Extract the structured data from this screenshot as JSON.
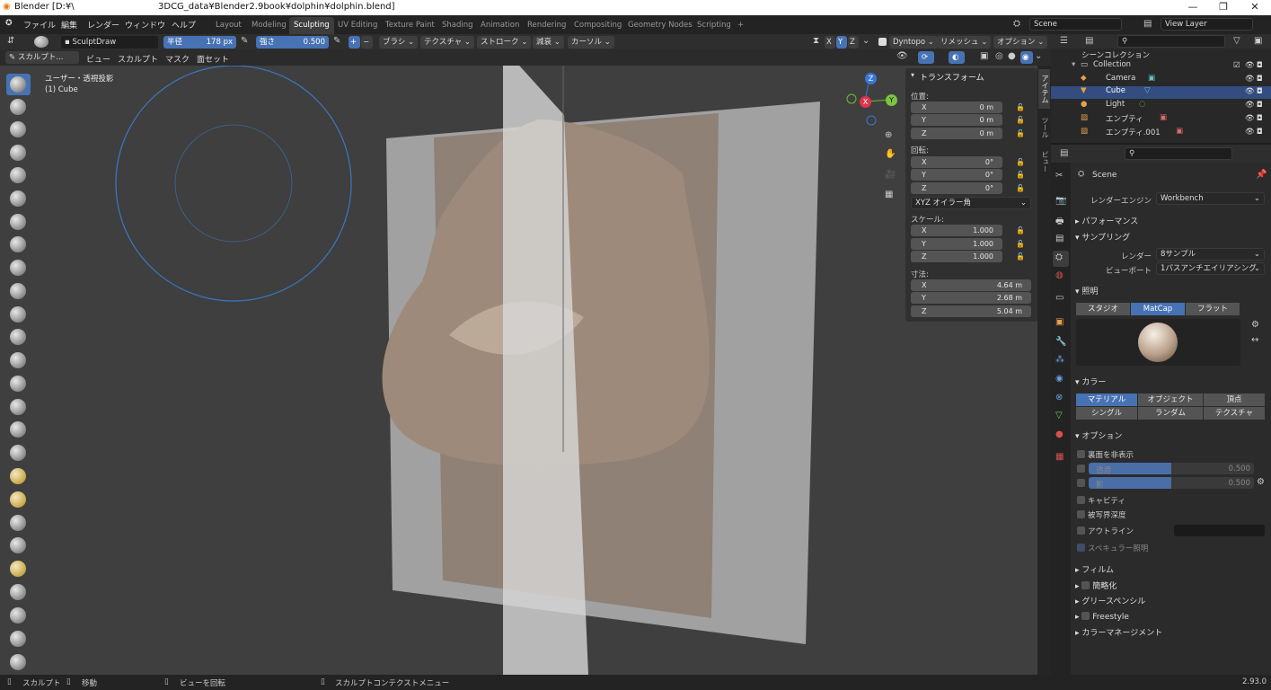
{
  "title": {
    "app": "Blender [D:¥\\",
    "path": "3DCG_data¥Blender2.9book¥dolphin¥dolphin.blend]"
  },
  "window_buttons": [
    "—",
    "❐",
    "✕"
  ],
  "menus": [
    "ファイル",
    "編集",
    "レンダー",
    "ウィンドウ",
    "ヘルプ"
  ],
  "workspaces": [
    "Layout",
    "Modeling",
    "Sculpting",
    "UV Editing",
    "Texture Paint",
    "Shading",
    "Animation",
    "Rendering",
    "Compositing",
    "Geometry Nodes",
    "Scripting"
  ],
  "active_workspace": "Sculpting",
  "add_tab": "+",
  "scene": "Scene",
  "view_layer": "View Layer",
  "tool_header": {
    "brush": "SculptDraw",
    "radius_label": "半径",
    "radius_value": "178 px",
    "strength_label": "強さ",
    "strength_value": "0.500",
    "plus": "+",
    "minus": "−",
    "menus": [
      "ブラシ",
      "テクスチャ",
      "ストローク",
      "減衰",
      "カーソル"
    ],
    "axes": [
      "X",
      "Y",
      "Z"
    ],
    "dyntopo": "Dyntopo",
    "remesh": "リメッシュ",
    "options": "オプション"
  },
  "mode_header": {
    "mode": "スカルプト...",
    "menus": [
      "ビュー",
      "スカルプト",
      "マスク",
      "面セット"
    ]
  },
  "viewport": {
    "view_name": "ユーザー・透視投影",
    "object_name": "(1) Cube"
  },
  "gizmo": {
    "x": "X",
    "y": "Y",
    "z": "Z"
  },
  "npanel": {
    "header": "トランスフォーム",
    "location_label": "位置:",
    "location": [
      {
        "axis": "X",
        "value": "0 m"
      },
      {
        "axis": "Y",
        "value": "0 m"
      },
      {
        "axis": "Z",
        "value": "0 m"
      }
    ],
    "rotation_label": "回転:",
    "rotation": [
      {
        "axis": "X",
        "value": "0°"
      },
      {
        "axis": "Y",
        "value": "0°"
      },
      {
        "axis": "Z",
        "value": "0°"
      }
    ],
    "rotation_mode": "XYZ オイラー角",
    "scale_label": "スケール:",
    "scale": [
      {
        "axis": "X",
        "value": "1.000"
      },
      {
        "axis": "Y",
        "value": "1.000"
      },
      {
        "axis": "Z",
        "value": "1.000"
      }
    ],
    "dimensions_label": "寸法:",
    "dimensions": [
      {
        "axis": "X",
        "value": "4.64 m"
      },
      {
        "axis": "Y",
        "value": "2.68 m"
      },
      {
        "axis": "Z",
        "value": "5.04 m"
      }
    ]
  },
  "side_tabs": [
    "アイテム",
    "ツール",
    "ビュー"
  ],
  "outliner": {
    "root": "シーンコレクション",
    "items": [
      {
        "name": "Collection"
      },
      {
        "name": "Camera"
      },
      {
        "name": "Cube"
      },
      {
        "name": "Light"
      },
      {
        "name": "エンプティ"
      },
      {
        "name": "エンプティ.001"
      }
    ]
  },
  "properties": {
    "scene": "Scene",
    "render_engine_label": "レンダーエンジン",
    "render_engine": "Workbench",
    "performance": "パフォーマンス",
    "sampling": "サンプリング",
    "render_label": "レンダー",
    "render_samples": "8サンプル",
    "viewport_label": "ビューポート",
    "viewport_aa": "1パスアンチエイリアシング",
    "lighting": "照明",
    "light_modes": [
      "スタジオ",
      "MatCap",
      "フラット"
    ],
    "light_mode_active": "MatCap",
    "color": "カラー",
    "color_modes": [
      "マテリアル",
      "オブジェクト",
      "頂点",
      "シングル",
      "ランダム",
      "テクスチャ"
    ],
    "color_active": "マテリアル",
    "options": "オプション",
    "backface": "裏面を非表示",
    "xray_label": "透過",
    "xray_value": "0.500",
    "shadow_label": "影",
    "shadow_value": "0.500",
    "cavity": "キャビティ",
    "dof": "被写界深度",
    "outline": "アウトライン",
    "specular": "スペキュラー照明",
    "film": "フィルム",
    "simplify": "簡略化",
    "grease_pencil": "グリースペンシル",
    "freestyle": "Freestyle",
    "color_management": "カラーマネージメント"
  },
  "status": {
    "sculpt": "スカルプト",
    "move": "移動",
    "rotate": "ビューを回転",
    "context": "スカルプトコンテクストメニュー",
    "version": "2.93.0"
  },
  "colors": {
    "accent": "#4772b3",
    "mesh": "#8c7b6d",
    "plane": "#bdbdbd",
    "brush_circle": "#3b78c2"
  }
}
